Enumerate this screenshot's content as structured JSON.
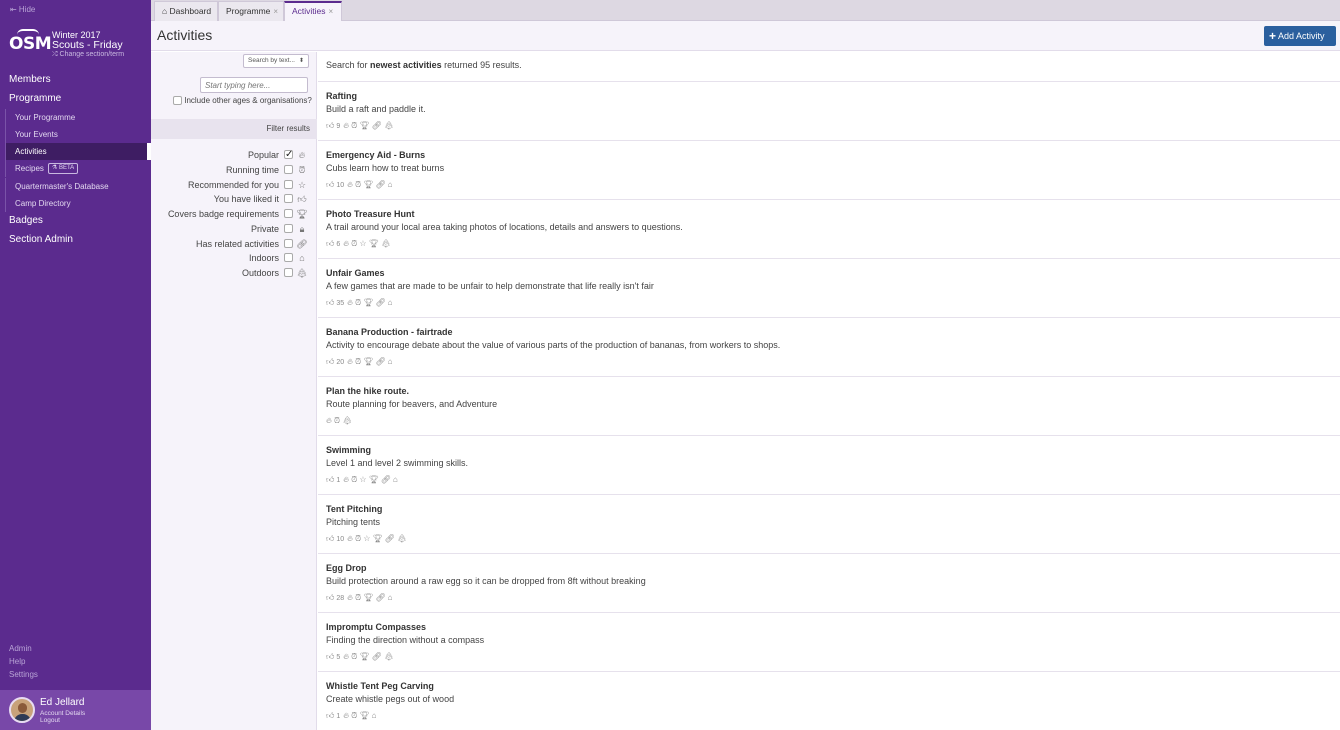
{
  "sidebar": {
    "hide_label": "⇤ Hide",
    "logo": "OSM",
    "term": "Winter 2017",
    "section": "Scouts - Friday",
    "change": "⤮ Change section/term",
    "nav": {
      "members": "Members",
      "programme": "Programme",
      "sub": {
        "your_programme": "Your Programme",
        "your_events": "Your Events",
        "activities": "Activities",
        "recipes": "Recipes",
        "recipes_badge": "⚗ BETA",
        "quartermaster": "Quartermaster's Database",
        "camp_directory": "Camp Directory"
      },
      "badges": "Badges",
      "section_admin": "Section Admin"
    },
    "footer": {
      "admin": "Admin",
      "help": "Help",
      "settings": "Settings"
    },
    "user": {
      "name": "Ed Jellard",
      "account": "Account Details",
      "logout": "Logout"
    }
  },
  "tabs": {
    "dashboard": "Dashboard",
    "programme": "Programme",
    "activities": "Activities",
    "close": "×",
    "home_icon": "⌂"
  },
  "header": {
    "title": "Activities",
    "add_button": "Add Activity",
    "add_icon": "+"
  },
  "filters": {
    "search_mode": "Search by text...",
    "search_caret": "⬍",
    "search_placeholder": "Start typing here...",
    "include_other": "Include other ages & organisations?",
    "heading": "Filter results",
    "items": [
      {
        "label": "Popular",
        "checked": true,
        "icon": "🔥︎"
      },
      {
        "label": "Running time",
        "checked": false,
        "icon": "⏰︎"
      },
      {
        "label": "Recommended for you",
        "checked": false,
        "icon": "☆"
      },
      {
        "label": "You have liked it",
        "checked": false,
        "icon": "👍︎"
      },
      {
        "label": "Covers badge requirements",
        "checked": false,
        "icon": "🏆︎"
      },
      {
        "label": "Private",
        "checked": false,
        "icon": "🔒︎"
      },
      {
        "label": "Has related activities",
        "checked": false,
        "icon": "🔗︎"
      },
      {
        "label": "Indoors",
        "checked": false,
        "icon": "⌂"
      },
      {
        "label": "Outdoors",
        "checked": false,
        "icon": "🌲︎"
      }
    ]
  },
  "results": {
    "summary_prefix": "Search for",
    "summary_query": "newest activities",
    "summary_suffix": "returned 95 results.",
    "activities": [
      {
        "title": "Rafting",
        "description": "Build a raft and paddle it.",
        "likes": "9",
        "icons": [
          "🔥︎",
          "⏰︎",
          "🏆︎",
          "🔗︎",
          "🌲︎"
        ]
      },
      {
        "title": "Emergency Aid - Burns",
        "description": "Cubs learn how to treat burns",
        "likes": "10",
        "icons": [
          "🔥︎",
          "⏰︎",
          "🏆︎",
          "🔗︎",
          "⌂"
        ]
      },
      {
        "title": "Photo Treasure Hunt",
        "description": "A trail around your local area taking photos of locations, details and answers to questions.",
        "likes": "6",
        "icons": [
          "🔥︎",
          "⏰︎",
          "☆",
          "🏆︎",
          "🌲︎"
        ]
      },
      {
        "title": "Unfair Games",
        "description": "A few games that are made to be unfair to help demonstrate that life really isn't fair",
        "likes": "35",
        "icons": [
          "🔥︎",
          "⏰︎",
          "🏆︎",
          "🔗︎",
          "⌂"
        ]
      },
      {
        "title": "Banana Production - fairtrade",
        "description": "Activity to encourage debate about the value of various parts of the production of bananas, from workers to shops.",
        "likes": "20",
        "icons": [
          "🔥︎",
          "⏰︎",
          "🏆︎",
          "🔗︎",
          "⌂"
        ]
      },
      {
        "title": "Plan the hike route.",
        "description": "Route planning for beavers, and Adventure",
        "likes": "",
        "icons": [
          "🔥︎",
          "⏰︎",
          "🌲︎"
        ]
      },
      {
        "title": "Swimming",
        "description": "Level 1 and level 2 swimming skills.",
        "likes": "1",
        "icons": [
          "🔥︎",
          "⏰︎",
          "☆",
          "🏆︎",
          "🔗︎",
          "⌂"
        ]
      },
      {
        "title": "Tent Pitching",
        "description": "Pitching tents",
        "likes": "10",
        "icons": [
          "🔥︎",
          "⏰︎",
          "☆",
          "🏆︎",
          "🔗︎",
          "🌲︎"
        ]
      },
      {
        "title": "Egg Drop",
        "description": "Build protection around a raw egg so it can be dropped from 8ft without breaking",
        "likes": "28",
        "icons": [
          "🔥︎",
          "⏰︎",
          "🏆︎",
          "🔗︎",
          "⌂"
        ]
      },
      {
        "title": "Impromptu Compasses",
        "description": "Finding the direction without a compass",
        "likes": "5",
        "icons": [
          "🔥︎",
          "⏰︎",
          "🏆︎",
          "🔗︎",
          "🌲︎"
        ]
      },
      {
        "title": "Whistle Tent Peg Carving",
        "description": "Create whistle pegs out of wood",
        "likes": "1",
        "icons": [
          "🔥︎",
          "⏰︎",
          "🏆︎",
          "⌂"
        ]
      }
    ]
  },
  "colors": {
    "sidebar": "#5b2b8e",
    "accent": "#2b5f9e",
    "panel": "#f6f3fa"
  }
}
